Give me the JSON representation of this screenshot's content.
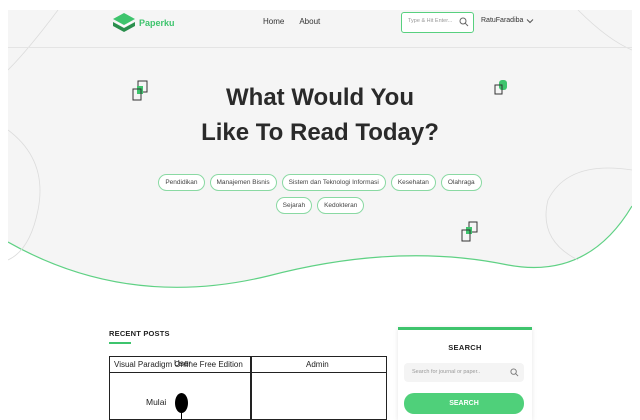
{
  "brand": {
    "name": "Paperku",
    "color": "#3ec46d"
  },
  "nav": {
    "home": "Home",
    "about": "About"
  },
  "header_search": {
    "placeholder": "Type & Hit Enter..."
  },
  "user": {
    "name": "RatuFaradiba"
  },
  "hero": {
    "title_line1": "What Would You",
    "title_line2": "Like To Read Today?",
    "tags_row1": [
      "Pendidikan",
      "Manajemen Bisnis",
      "Sistem dan Teknologi Informasi",
      "Kesehatan",
      "Olahraga"
    ],
    "tags_row2": [
      "Sejarah",
      "Kedokteran"
    ]
  },
  "recent_posts": {
    "heading": "RECENT POSTS",
    "image_text": {
      "left_header": "Visual Paradigm Online Free Edition",
      "overlap_text": "User",
      "right_header": "Admin",
      "start_label": "Mulai"
    }
  },
  "sidebar_search": {
    "title": "SEARCH",
    "placeholder": "Search for journal or paper..",
    "button": "SEARCH"
  },
  "icons": [
    "logo-book-icon",
    "search-icon",
    "chevron-down-icon",
    "decorative-squares-icon"
  ]
}
